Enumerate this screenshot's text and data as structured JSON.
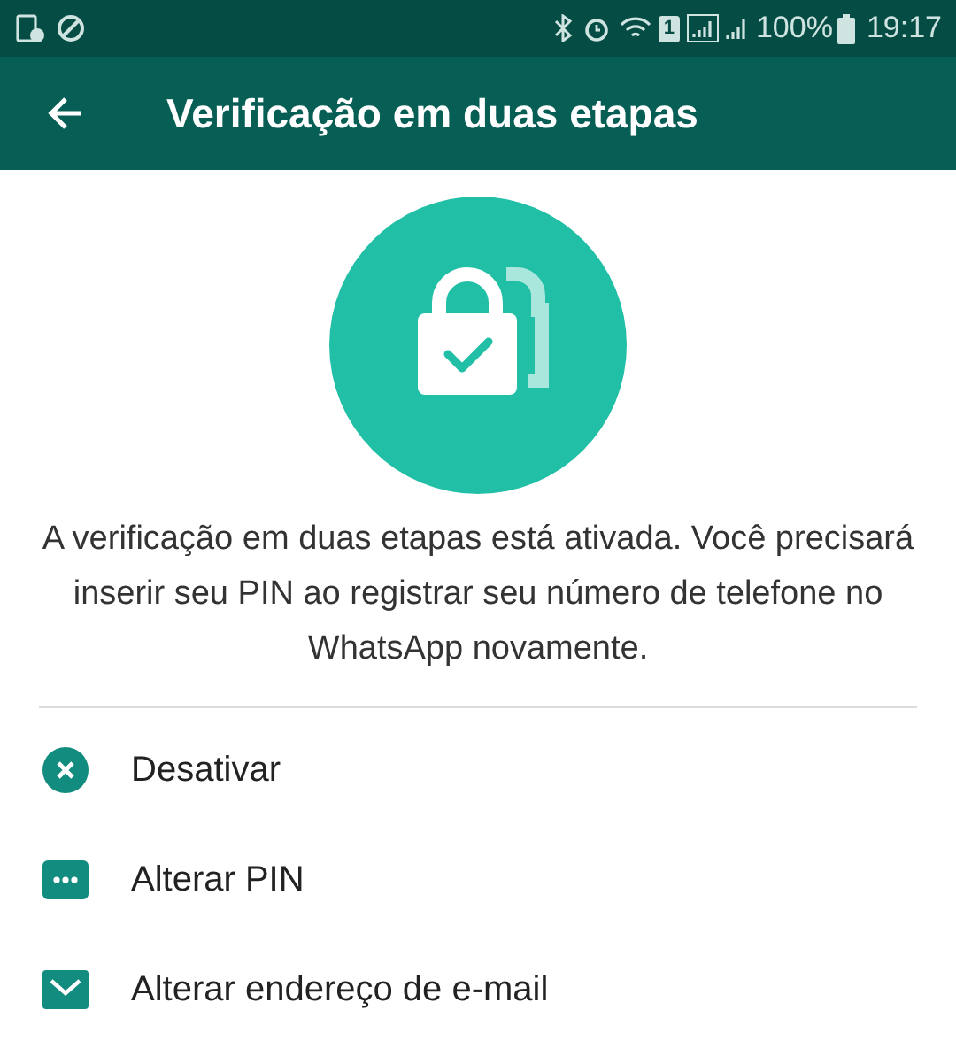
{
  "status_bar": {
    "sim_slot": "1",
    "battery": "100%",
    "time": "19:17"
  },
  "app_bar": {
    "title": "Verificação em duas etapas"
  },
  "description": "A verificação em duas etapas está ativada. Você precisará inserir seu PIN ao registrar seu número de telefone no WhatsApp novamente.",
  "actions": [
    {
      "kind": "disable",
      "label": "Desativar"
    },
    {
      "kind": "pin",
      "label": "Alterar PIN"
    },
    {
      "kind": "email",
      "label": "Alterar endereço de e-mail"
    }
  ]
}
